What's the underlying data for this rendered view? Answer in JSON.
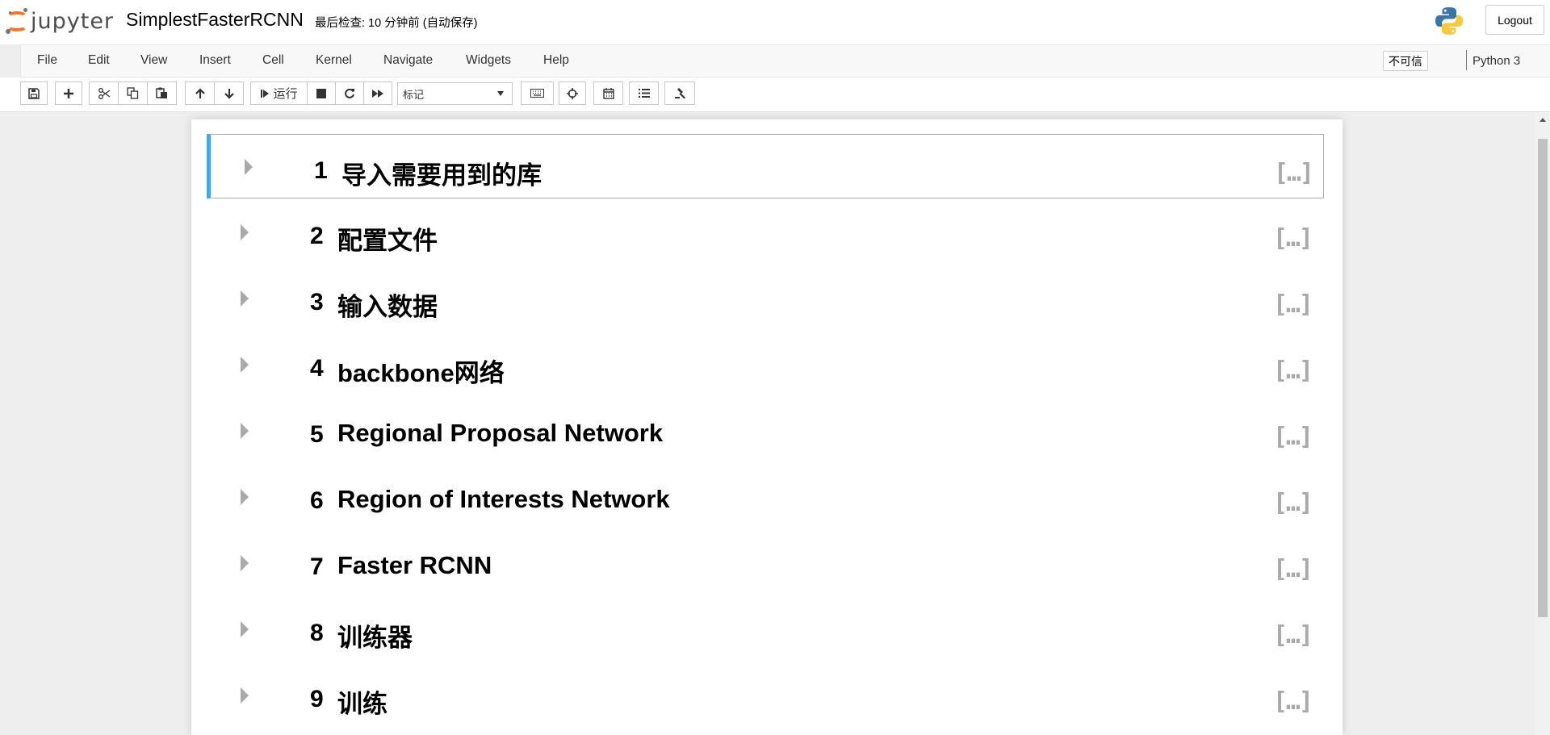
{
  "header": {
    "logo_text": "jupyter",
    "notebook_title": "SimplestFasterRCNN",
    "checkpoint": "最后检查: 10 分钟前  (自动保存)",
    "logout_label": "Logout"
  },
  "menubar": {
    "items": [
      "File",
      "Edit",
      "View",
      "Insert",
      "Cell",
      "Kernel",
      "Navigate",
      "Widgets",
      "Help"
    ],
    "trust_label": "不可信",
    "kernel_name": "Python 3"
  },
  "toolbar": {
    "run_label": "运行",
    "cell_type_selected": "标记"
  },
  "cells": [
    {
      "number": "1",
      "heading": "导入需要用到的库",
      "collapsed": "[…]"
    },
    {
      "number": "2",
      "heading": "配置文件",
      "collapsed": "[…]"
    },
    {
      "number": "3",
      "heading": "输入数据",
      "collapsed": "[…]"
    },
    {
      "number": "4",
      "heading": "backbone网络",
      "collapsed": "[…]"
    },
    {
      "number": "5",
      "heading": "Regional Proposal Network",
      "collapsed": "[…]"
    },
    {
      "number": "6",
      "heading": "Region of Interests Network",
      "collapsed": "[…]"
    },
    {
      "number": "7",
      "heading": "Faster RCNN",
      "collapsed": "[…]"
    },
    {
      "number": "8",
      "heading": "训练器",
      "collapsed": "[…]"
    },
    {
      "number": "9",
      "heading": "训练",
      "collapsed": "[…]"
    }
  ],
  "colors": {
    "accent_orange": "#f37726",
    "selected_cell_border": "#42a5f5"
  }
}
